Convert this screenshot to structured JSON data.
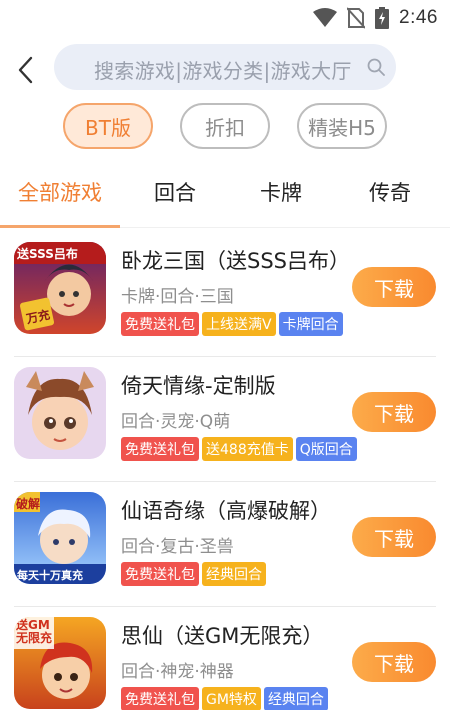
{
  "status_bar": {
    "time": "2:46",
    "icons": [
      "wifi-icon",
      "no-sim-icon",
      "battery-charging-icon"
    ]
  },
  "header": {
    "search_placeholder": "搜索游戏|游戏分类|游戏大厅",
    "icons": [
      "back-arrow-icon",
      "search-icon"
    ]
  },
  "filters": [
    {
      "label": "BT版",
      "active": true
    },
    {
      "label": "折扣",
      "active": false
    },
    {
      "label": "精装H5",
      "active": false
    }
  ],
  "tabs": [
    {
      "label": "全部游戏",
      "active": true
    },
    {
      "label": "回合",
      "active": false
    },
    {
      "label": "卡牌",
      "active": false
    },
    {
      "label": "传奇",
      "active": false
    }
  ],
  "games": [
    {
      "name": "卧龙三国（送SSS吕布）",
      "genre": "卡牌·回合·三国",
      "tags": [
        {
          "label": "免费送礼包",
          "color": "#f0534d"
        },
        {
          "label": "上线送满V",
          "color": "#f6b21d"
        },
        {
          "label": "卡牌回合",
          "color": "#5a83f0"
        }
      ],
      "icon_text_top": "送SSS吕布",
      "icon_text_badge": "万充",
      "download_label": "下载"
    },
    {
      "name": "倚天情缘-定制版",
      "genre": "回合·灵宠·Q萌",
      "tags": [
        {
          "label": "免费送礼包",
          "color": "#f0534d"
        },
        {
          "label": "送488充值卡",
          "color": "#f6b21d"
        },
        {
          "label": "Q版回合",
          "color": "#5a83f0"
        }
      ],
      "download_label": "下载"
    },
    {
      "name": "仙语奇缘（高爆破解）",
      "genre": "回合·复古·圣兽",
      "tags": [
        {
          "label": "免费送礼包",
          "color": "#f0534d"
        },
        {
          "label": "经典回合",
          "color": "#f6b21d"
        }
      ],
      "icon_text_top": "破解",
      "icon_text_bottom": "每天十万真充",
      "download_label": "下载"
    },
    {
      "name": "思仙（送GM无限充）",
      "genre": "回合·神宠·神器",
      "tags": [
        {
          "label": "免费送礼包",
          "color": "#f0534d"
        },
        {
          "label": "GM特权",
          "color": "#f6b21d"
        },
        {
          "label": "经典回合",
          "color": "#5a83f0"
        }
      ],
      "icon_text_top": "送GM无限充",
      "download_label": "下载"
    }
  ],
  "colors": {
    "accent": "#f07f33",
    "chip_active_bg": "#ffe9d8",
    "download_gradient": [
      "#fcab4a",
      "#f98a2f"
    ]
  }
}
